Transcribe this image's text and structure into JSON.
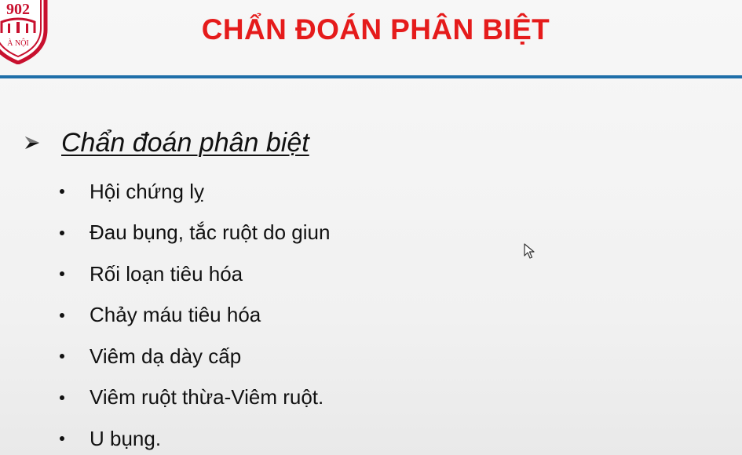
{
  "slide": {
    "title": "CHẨN ĐOÁN PHÂN BIỆT",
    "logo_text_top": "902",
    "logo_text_bottom": "À NỘI",
    "section_heading": "Chẩn đoán phân biệt",
    "bullets": [
      "Hội chứng lỵ",
      "Đau bụng, tắc ruột do giun",
      "Rối loạn tiêu hóa",
      "Chảy máu tiêu hóa",
      "Viêm dạ dày cấp",
      "Viêm ruột thừa-Viêm ruột.",
      "U bụng."
    ]
  },
  "colors": {
    "title": "#e51b1b",
    "rule": "#1f6fa9",
    "logo": "#c8102e"
  },
  "icons": {
    "heading_marker": "arrowhead-icon",
    "bullet_marker": "bullet-dot",
    "logo": "university-seal-logo",
    "cursor": "mouse-cursor-icon"
  }
}
